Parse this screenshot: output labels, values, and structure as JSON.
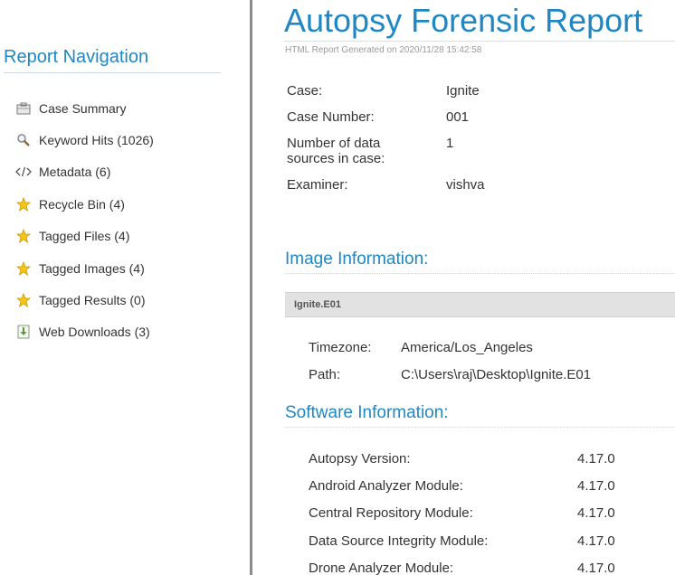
{
  "nav": {
    "title": "Report Navigation",
    "items": [
      {
        "label": "Case Summary",
        "icon": "briefcase-icon"
      },
      {
        "label": "Keyword Hits (1026)",
        "icon": "magnifier-icon"
      },
      {
        "label": "Metadata (6)",
        "icon": "code-icon"
      },
      {
        "label": "Recycle Bin (4)",
        "icon": "star-icon"
      },
      {
        "label": "Tagged Files (4)",
        "icon": "star-icon"
      },
      {
        "label": "Tagged Images (4)",
        "icon": "star-icon"
      },
      {
        "label": "Tagged Results (0)",
        "icon": "star-icon"
      },
      {
        "label": "Web Downloads (3)",
        "icon": "download-icon"
      }
    ]
  },
  "report": {
    "title": "Autopsy Forensic Report",
    "generated": "HTML Report Generated on 2020/11/28 15:42:58",
    "case_info": [
      {
        "key": "Case:",
        "value": "Ignite"
      },
      {
        "key": "Case Number:",
        "value": "001"
      },
      {
        "key": "Number of data sources in case:",
        "value": "1"
      },
      {
        "key": "Examiner:",
        "value": "vishva"
      }
    ]
  },
  "image_info": {
    "heading": "Image Information:",
    "image_name": "Ignite.E01",
    "rows": [
      {
        "key": "Timezone:",
        "value": "America/Los_Angeles"
      },
      {
        "key": "Path:",
        "value": "C:\\Users\\raj\\Desktop\\Ignite.E01"
      }
    ]
  },
  "software_info": {
    "heading": "Software Information:",
    "rows": [
      {
        "key": "Autopsy Version:",
        "value": "4.17.0"
      },
      {
        "key": "Android Analyzer Module:",
        "value": "4.17.0"
      },
      {
        "key": "Central Repository Module:",
        "value": "4.17.0"
      },
      {
        "key": "Data Source Integrity Module:",
        "value": "4.17.0"
      },
      {
        "key": "Drone Analyzer Module:",
        "value": "4.17.0"
      }
    ]
  },
  "colors": {
    "accent": "#1e87c4",
    "divider": "#8c8c8c",
    "star": "#f5c518"
  }
}
